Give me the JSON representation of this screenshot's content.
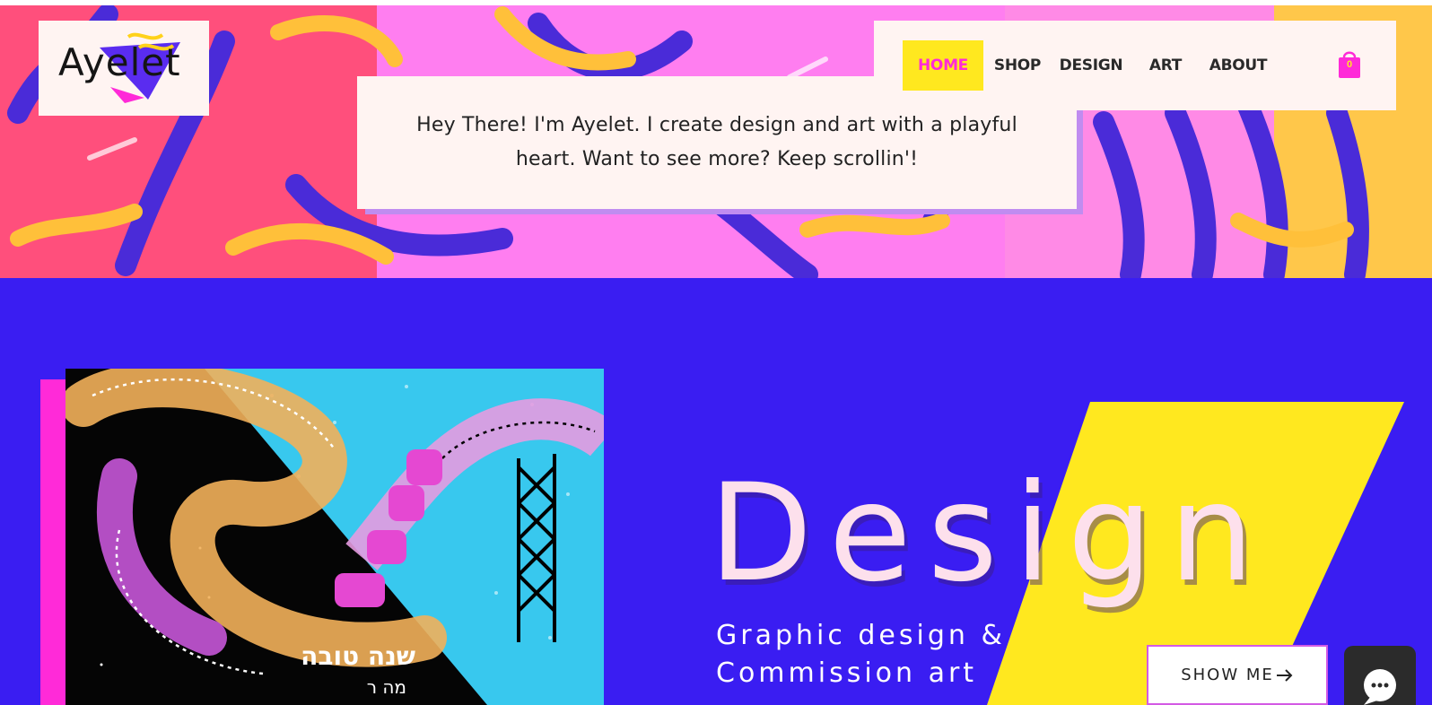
{
  "logo": {
    "text": "Ayelet"
  },
  "nav": {
    "items": [
      {
        "label": "HOME",
        "active": true
      },
      {
        "label": "SHOP",
        "active": false
      },
      {
        "label": "DESIGN",
        "active": false
      },
      {
        "label": "ART",
        "active": false
      },
      {
        "label": "ABOUT",
        "active": false
      }
    ],
    "cart_count": "0"
  },
  "hero": {
    "intro": "Hey There! I'm Ayelet. I create design and art with a playful heart. Want to see more? Keep scrollin'!"
  },
  "design_section": {
    "title": "Design",
    "subtitle_line1": "Graphic design &",
    "subtitle_line2": "Commission art",
    "button_label": "SHOW ME",
    "button_icon": "arrow-right-icon",
    "artwork_text": "שנה טובה",
    "artwork_text_small": "מה ר"
  },
  "chat": {
    "icon": "chat-icon"
  },
  "colors": {
    "accent_yellow": "#ffe81f",
    "accent_pink": "#ff2ad8",
    "section_blue": "#3a1df2",
    "box_cream": "#fff4f2"
  }
}
